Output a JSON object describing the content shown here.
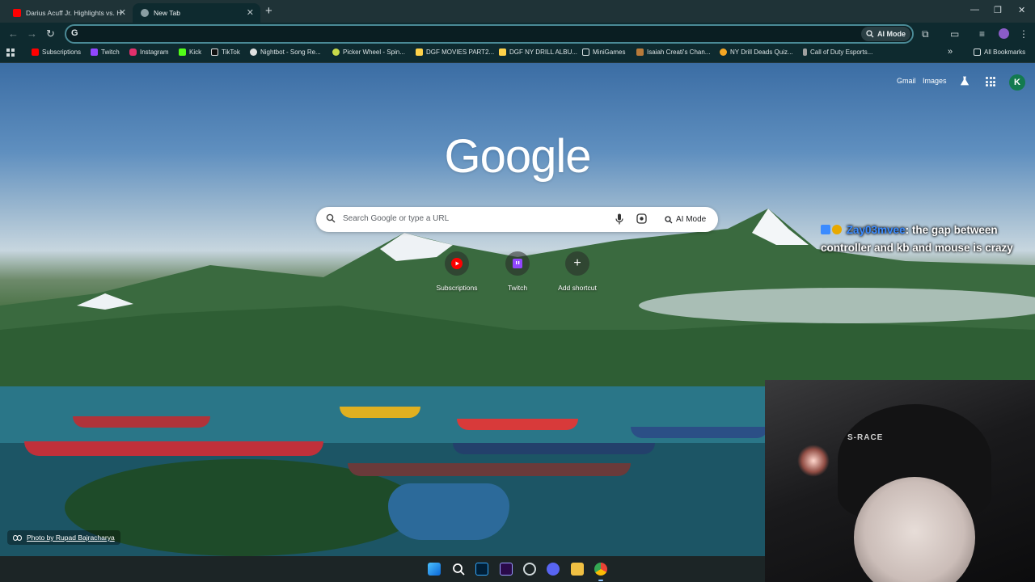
{
  "browser": {
    "tabs": [
      {
        "title": "Darius Acuff Jr. Highlights vs. H",
        "active": false
      },
      {
        "title": "New Tab",
        "active": true
      }
    ],
    "omnibox": {
      "value": "",
      "placeholder": ""
    },
    "ai_mode_label": "AI Mode"
  },
  "bookmarks": [
    {
      "label": "Subscriptions",
      "icon": "youtube-icon",
      "color": "#ff0000"
    },
    {
      "label": "Twitch",
      "icon": "twitch-icon",
      "color": "#9146ff"
    },
    {
      "label": "Instagram",
      "icon": "instagram-icon",
      "color": "#e1306c"
    },
    {
      "label": "Kick",
      "icon": "kick-icon",
      "color": "#53fc18"
    },
    {
      "label": "TikTok",
      "icon": "tiktok-icon",
      "color": "#111111"
    },
    {
      "label": "Nightbot - Song Re...",
      "icon": "nightbot-icon",
      "color": "#e0e0e0"
    },
    {
      "label": "Picker Wheel - Spin...",
      "icon": "wheel-icon",
      "color": "#c8d94a"
    },
    {
      "label": "DGF MOVIES PART2...",
      "icon": "doc-icon",
      "color": "#ffd24a"
    },
    {
      "label": "DGF NY DRILL ALBU...",
      "icon": "doc-icon",
      "color": "#ffd24a"
    },
    {
      "label": "MiniGames",
      "icon": "folder-icon",
      "color": "#d9e2e4"
    },
    {
      "label": "Isaiah Creati's Chan...",
      "icon": "channel-icon",
      "color": "#b87a3a"
    },
    {
      "label": "NY Drill Deads Quiz...",
      "icon": "quiz-icon",
      "color": "#f5a623"
    },
    {
      "label": "Call of Duty Esports...",
      "icon": "cod-icon",
      "color": "#a0a0a0"
    }
  ],
  "all_bookmarks_label": "All Bookmarks",
  "ntp": {
    "top_links": {
      "gmail": "Gmail",
      "images": "Images",
      "avatar_letter": "K"
    },
    "logo": "Google",
    "search_placeholder": "Search Google or type a URL",
    "ai_mode_label": "AI Mode",
    "shortcuts": [
      {
        "label": "Subscriptions",
        "icon": "youtube-icon"
      },
      {
        "label": "Twitch",
        "icon": "twitch-icon"
      },
      {
        "label": "Add shortcut",
        "icon": "plus-icon"
      }
    ],
    "photo_credit": "Photo by Rupad Bajracharya"
  },
  "stream_chat": {
    "username": "Zay03mvee",
    "message": ": the gap between controller and kb and mouse is crazy"
  },
  "webcam": {
    "brand_text": "S-RACE"
  },
  "taskbar": [
    {
      "icon": "windows-start-icon"
    },
    {
      "icon": "search-icon"
    },
    {
      "icon": "photoshop-icon"
    },
    {
      "icon": "premiere-icon"
    },
    {
      "icon": "obs-icon"
    },
    {
      "icon": "discord-icon"
    },
    {
      "icon": "file-explorer-icon"
    },
    {
      "icon": "chrome-icon"
    }
  ],
  "colors": {
    "accent": "#4a8a96",
    "tabstrip": "#1f3337",
    "toolbar": "#0e2a2f"
  }
}
